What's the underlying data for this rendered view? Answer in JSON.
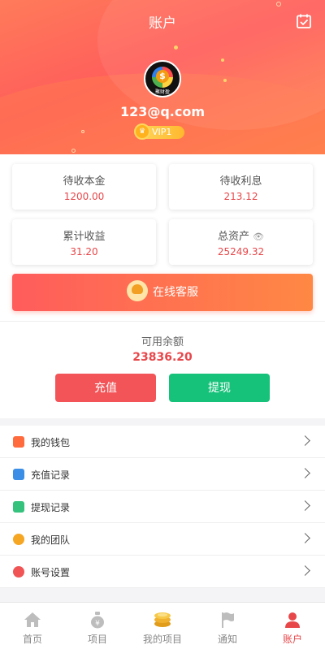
{
  "header": {
    "title": "账户",
    "email": "123@q.com",
    "vip": "VIP1",
    "avatar_label": "聚财盈"
  },
  "stats": [
    {
      "label": "待收本金",
      "value": "1200.00"
    },
    {
      "label": "待收利息",
      "value": "213.12"
    },
    {
      "label": "累计收益",
      "value": "31.20"
    },
    {
      "label": "总资产",
      "value": "25249.32"
    }
  ],
  "service": {
    "label": "在线客服"
  },
  "balance": {
    "label": "可用余额",
    "value": "23836.20",
    "recharge_label": "充值",
    "withdraw_label": "提现"
  },
  "menu": [
    {
      "label": "我的钱包",
      "icon": "wallet-icon",
      "color": "#ff6b3d"
    },
    {
      "label": "充值记录",
      "icon": "recharge-record-icon",
      "color": "#3a8ee6"
    },
    {
      "label": "提现记录",
      "icon": "withdraw-record-icon",
      "color": "#35c27c"
    },
    {
      "label": "我的团队",
      "icon": "team-icon",
      "color": "#f5a623"
    },
    {
      "label": "账号设置",
      "icon": "settings-icon",
      "color": "#f05454"
    }
  ],
  "nav": [
    {
      "label": "首页",
      "icon": "home-icon",
      "active": false
    },
    {
      "label": "项目",
      "icon": "money-bag-icon",
      "active": false
    },
    {
      "label": "我的项目",
      "icon": "coins-icon",
      "active": false
    },
    {
      "label": "通知",
      "icon": "flag-icon",
      "active": false
    },
    {
      "label": "账户",
      "icon": "user-icon",
      "active": true
    }
  ],
  "colors": {
    "accent": "#e8474a",
    "green": "#16c27a",
    "header_gradient": [
      "#ff7b5a",
      "#ff5e5b",
      "#ff8a4c"
    ]
  }
}
